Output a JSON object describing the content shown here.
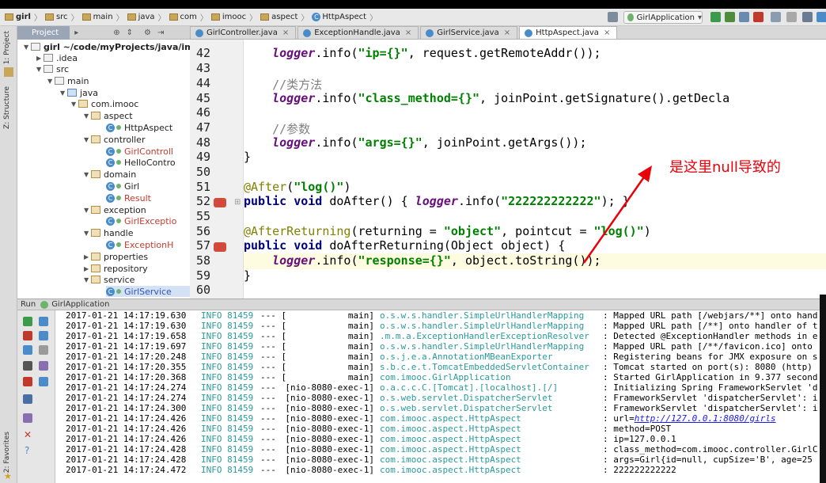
{
  "breadcrumb": [
    "girl",
    "src",
    "main",
    "java",
    "com",
    "imooc",
    "aspect",
    "HttpAspect"
  ],
  "run_config": "GirlApplication",
  "left_strip": {
    "project": "1: Project",
    "structure": "Z: Structure",
    "favorites": "2: Favorites"
  },
  "project_panel": {
    "tab": "Project",
    "root": "girl  ~/code/myProjects/java/imc",
    "nodes": [
      ".idea",
      "src",
      "main",
      "java",
      "com.imooc",
      "aspect",
      "HttpAspect",
      "controller",
      "GirlControll",
      "HelloContro",
      "domain",
      "Girl",
      "Result",
      "exception",
      "GirlExceptio",
      "handle",
      "ExceptionH",
      "properties",
      "repository",
      "service",
      "GirlService"
    ]
  },
  "editor_tabs": [
    {
      "label": "GirlController.java",
      "active": false
    },
    {
      "label": "ExceptionHandle.java",
      "active": false
    },
    {
      "label": "GirlService.java",
      "active": false
    },
    {
      "label": "HttpAspect.java",
      "active": true
    }
  ],
  "line_numbers": [
    "42",
    "43",
    "44",
    "45",
    "46",
    "47",
    "48",
    "49",
    "50",
    "51",
    "52",
    "55",
    "56",
    "57",
    "58",
    "59",
    "60"
  ],
  "code": {
    "l42_obj": "logger",
    "l42_rest": ".info(",
    "l42_str": "\"ip={}\"",
    "l42_end": ", request.getRemoteAddr());",
    "l44_cmt": "//类方法",
    "l45_obj": "logger",
    "l45_rest": ".info(",
    "l45_str": "\"class_method={}\"",
    "l45_end": ", joinPoint.getSignature().getDecla",
    "l47_cmt": "//参数",
    "l48_obj": "logger",
    "l48_rest": ".info(",
    "l48_str": "\"args={}\"",
    "l48_end": ", joinPoint.getArgs());",
    "l49": "}",
    "l51_ann": "@After",
    "l51_rest": "(",
    "l51_str": "\"log()\"",
    "l51_end": ")",
    "l52_kw1": "public",
    "l52_kw2": "void",
    "l52_name": " doAfter() { ",
    "l52_obj": "logger",
    "l52_rest": ".info(",
    "l52_str": "\"222222222222\"",
    "l52_end": "); }",
    "l56_ann": "@AfterReturning",
    "l56_rest": "(returning = ",
    "l56_str1": "\"object\"",
    "l56_mid": ", pointcut = ",
    "l56_str2": "\"log()\"",
    "l56_end": ")",
    "l57_kw1": "public",
    "l57_kw2": "void",
    "l57_name": " doAfterReturning(Object object) {",
    "l58_obj": "logger",
    "l58_rest": ".info(",
    "l58_str": "\"response={}\"",
    "l58_end": ", object.toString());",
    "l59": "}"
  },
  "annotation_note": "是这里null导致的",
  "run_panel": {
    "title": "Run",
    "config": "GirlApplication"
  },
  "log": [
    {
      "time": "2017-01-21 14:17:19.630",
      "level": "INFO 81459",
      "thread": "main]",
      "logger": "o.s.w.s.handler.SimpleUrlHandlerMapping",
      "msg": ": Mapped URL path [/webjars/**] onto hand"
    },
    {
      "time": "2017-01-21 14:17:19.630",
      "level": "INFO 81459",
      "thread": "main]",
      "logger": "o.s.w.s.handler.SimpleUrlHandlerMapping",
      "msg": ": Mapped URL path [/**] onto handler of t"
    },
    {
      "time": "2017-01-21 14:17:19.658",
      "level": "INFO 81459",
      "thread": "main]",
      "logger": ".m.m.a.ExceptionHandlerExceptionResolver",
      "msg": ": Detected @ExceptionHandler methods in e"
    },
    {
      "time": "2017-01-21 14:17:19.697",
      "level": "INFO 81459",
      "thread": "main]",
      "logger": "o.s.w.s.handler.SimpleUrlHandlerMapping",
      "msg": ": Mapped URL path [/**/favicon.ico] onto"
    },
    {
      "time": "2017-01-21 14:17:20.248",
      "level": "INFO 81459",
      "thread": "main]",
      "logger": "o.s.j.e.a.AnnotationMBeanExporter",
      "msg": ": Registering beans for JMX exposure on s"
    },
    {
      "time": "2017-01-21 14:17:20.355",
      "level": "INFO 81459",
      "thread": "main]",
      "logger": "s.b.c.e.t.TomcatEmbeddedServletContainer",
      "msg": ": Tomcat started on port(s): 8080 (http)"
    },
    {
      "time": "2017-01-21 14:17:20.368",
      "level": "INFO 81459",
      "thread": "main]",
      "logger": "com.imooc.GirlApplication",
      "msg": ": Started GirlApplication in 9.377 second"
    },
    {
      "time": "2017-01-21 14:17:24.274",
      "level": "INFO 81459",
      "thread": "[nio-8080-exec-1]",
      "logger": "o.a.c.c.C.[Tomcat].[localhost].[/]",
      "msg": ": Initializing Spring FrameworkServlet 'd"
    },
    {
      "time": "2017-01-21 14:17:24.274",
      "level": "INFO 81459",
      "thread": "[nio-8080-exec-1]",
      "logger": "o.s.web.servlet.DispatcherServlet",
      "msg": ": FrameworkServlet 'dispatcherServlet': i"
    },
    {
      "time": "2017-01-21 14:17:24.300",
      "level": "INFO 81459",
      "thread": "[nio-8080-exec-1]",
      "logger": "o.s.web.servlet.DispatcherServlet",
      "msg": ": FrameworkServlet 'dispatcherServlet': i"
    },
    {
      "time": "2017-01-21 14:17:24.426",
      "level": "INFO 81459",
      "thread": "[nio-8080-exec-1]",
      "logger": "com.imooc.aspect.HttpAspect",
      "msg": ": url=",
      "link": "http://127.0.0.1:8080/girls"
    },
    {
      "time": "2017-01-21 14:17:24.426",
      "level": "INFO 81459",
      "thread": "[nio-8080-exec-1]",
      "logger": "com.imooc.aspect.HttpAspect",
      "msg": ": method=POST"
    },
    {
      "time": "2017-01-21 14:17:24.426",
      "level": "INFO 81459",
      "thread": "[nio-8080-exec-1]",
      "logger": "com.imooc.aspect.HttpAspect",
      "msg": ": ip=127.0.0.1"
    },
    {
      "time": "2017-01-21 14:17:24.428",
      "level": "INFO 81459",
      "thread": "[nio-8080-exec-1]",
      "logger": "com.imooc.aspect.HttpAspect",
      "msg": ": class_method=com.imooc.controller.GirlC"
    },
    {
      "time": "2017-01-21 14:17:24.428",
      "level": "INFO 81459",
      "thread": "[nio-8080-exec-1]",
      "logger": "com.imooc.aspect.HttpAspect",
      "msg": ": args=Girl{id=null, cupSize='B', age=25"
    },
    {
      "time": "2017-01-21 14:17:24.472",
      "level": "INFO 81459",
      "thread": "[nio-8080-exec-1]",
      "logger": "com.imooc.aspect.HttpAspect",
      "msg": ": 222222222222"
    }
  ]
}
